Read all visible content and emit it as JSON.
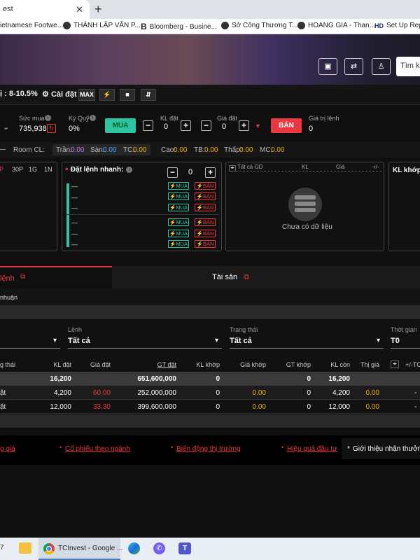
{
  "browser": {
    "tab_title": "est",
    "bookmarks": [
      "ietnamese Footwe...",
      "THÀNH LẬP VĂN P...",
      "Bloomberg - Busine...",
      "Sở Công Thương T...",
      "HOANG GIA - Than...",
      "Set Up Repr"
    ]
  },
  "header": {
    "search_placeholder": "Tìm k"
  },
  "toolbar": {
    "range_text": "ị : 8-10.5%",
    "settings_label": "Cài đặt",
    "max_label": "MAX"
  },
  "order": {
    "dropdown_caret": "⌄",
    "suc_mua_label": "Sức mua",
    "suc_mua_value": "735,938",
    "ky_quy_label": "Ký Quỹ",
    "ky_quy_value": "0%",
    "mua_label": "MUA",
    "kl_dat_label": "KL đặt",
    "kl_dat_value": "0",
    "gia_dat_label": "Giá đặt",
    "gia_dat_value": "0",
    "ban_label": "BÁN",
    "gia_tri_label": "Giá trị lệnh",
    "gia_tri_value": "0"
  },
  "price_strip": {
    "room_label": "Room CL:",
    "tran_label": "Trần:",
    "tran_value": "0.00",
    "san_label": "Sàn:",
    "san_value": "0.00",
    "tc_label": "TC:",
    "tc_value": "0.00",
    "cao_label": "Cao:",
    "cao_value": "0.00",
    "tb_label": "TB:",
    "tb_value": "0.00",
    "thap_label": "Thấp:",
    "thap_value": "0.00",
    "mc_label": "MC:",
    "mc_value": "0.00"
  },
  "chart_panel": {
    "tabs": [
      "P",
      "30P",
      "1G",
      "1N"
    ]
  },
  "quick_order": {
    "title": "Đặt lệnh nhanh:",
    "qty": "0",
    "buy_label": "MUA",
    "sell_label": "BÁN",
    "dash": "—"
  },
  "trade_log": {
    "col_all": "Tất cả GD",
    "col_kl": "KL",
    "col_gia": "Giá",
    "col_pm": "+/-",
    "empty_text": "Chưa có dữ liệu"
  },
  "match_panel": {
    "title": "KL khớp t"
  },
  "bottom_tabs": {
    "orders_label": "lệnh",
    "assets_label": "Tài sản"
  },
  "sub_label": "nhuận",
  "filters": {
    "lenh_label": "Lệnh",
    "lenh_value": "Tất cả",
    "trangthai_label": "Trạng thái",
    "trangthai_value": "Tất cả",
    "thoigian_label": "Thời gian",
    "thoigian_value": "T0"
  },
  "table": {
    "headers": [
      "g thái",
      "KL đặt",
      "Giá đặt",
      "GT đặt",
      "KL khớp",
      "Giá khớp",
      "GT khớp",
      "KL còn",
      "Thị giá",
      "+/-TC"
    ],
    "summary": {
      "kl_dat": "16,200",
      "gt_dat": "651,600,000",
      "kl_khop": "0",
      "gt_khop": "0",
      "kl_con": "16,200"
    },
    "rows": [
      {
        "status": "ặt",
        "kl_dat": "4,200",
        "gia_dat": "60.00",
        "gt_dat": "252,000,000",
        "kl_khop": "0",
        "gia_khop": "0.00",
        "gt_khop": "0",
        "kl_con": "4,200",
        "thi_gia": "0.00",
        "tc": "-"
      },
      {
        "status": "ặt",
        "kl_dat": "12,000",
        "gia_dat": "33.30",
        "gt_dat": "399,600,000",
        "kl_khop": "0",
        "gia_khop": "0.00",
        "gt_khop": "0",
        "kl_con": "12,000",
        "thi_gia": "0.00",
        "tc": "-"
      }
    ]
  },
  "footer_links": [
    "g giá",
    "Cổ phiếu theo ngành",
    "Biến động thị trường",
    "Hiệu quả đầu tư"
  ],
  "footer_note": "Giới thiệu nhận thưởng",
  "taskbar": {
    "clock": "7",
    "chrome_label": "TCInvest - Google ..."
  },
  "colors": {
    "buy": "#2ec4a2",
    "sell": "#e9383f",
    "ref": "#f0b000",
    "ceiling": "#c070ff",
    "floor": "#4aa8ff"
  }
}
